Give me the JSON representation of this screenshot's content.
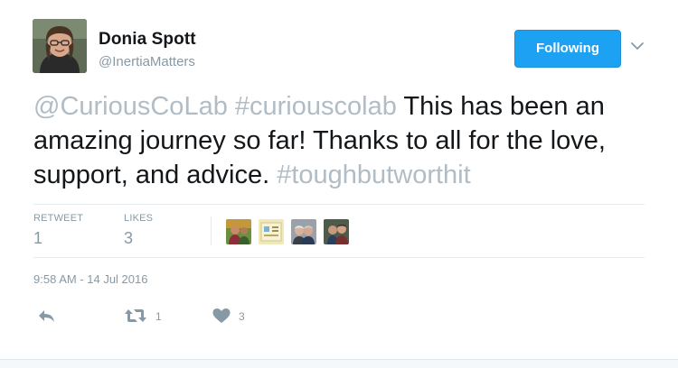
{
  "author": {
    "display_name": "Donia Spott",
    "screen_name": "@InertiaMatters"
  },
  "follow_button": {
    "label": "Following"
  },
  "tweet": {
    "segments": [
      {
        "type": "mention",
        "text": "@CuriousCoLab"
      },
      {
        "type": "text",
        "text": " "
      },
      {
        "type": "hashtag",
        "text": "#curiouscolab"
      },
      {
        "type": "text",
        "text": " This has been an amazing journey so far!  Thanks to all for the love, support, and advice.  "
      },
      {
        "type": "hashtag",
        "text": "#toughbutworthit"
      }
    ]
  },
  "stats": {
    "retweets_label": "RETWEET",
    "retweets_value": "1",
    "likes_label": "LIKES",
    "likes_value": "3"
  },
  "likers": [
    {
      "icon": "liker-avatar-1"
    },
    {
      "icon": "liker-avatar-2"
    },
    {
      "icon": "liker-avatar-3"
    },
    {
      "icon": "liker-avatar-4"
    }
  ],
  "timestamp": "9:58 AM - 14 Jul 2016",
  "actions": {
    "reply_icon": "reply-icon",
    "retweet_icon": "retweet-icon",
    "retweet_count": "1",
    "like_icon": "heart-icon",
    "like_count": "3"
  },
  "colors": {
    "accent": "#1da1f2",
    "muted": "#8899a6",
    "link_faded": "#b1bcc4",
    "text": "#14171a"
  }
}
